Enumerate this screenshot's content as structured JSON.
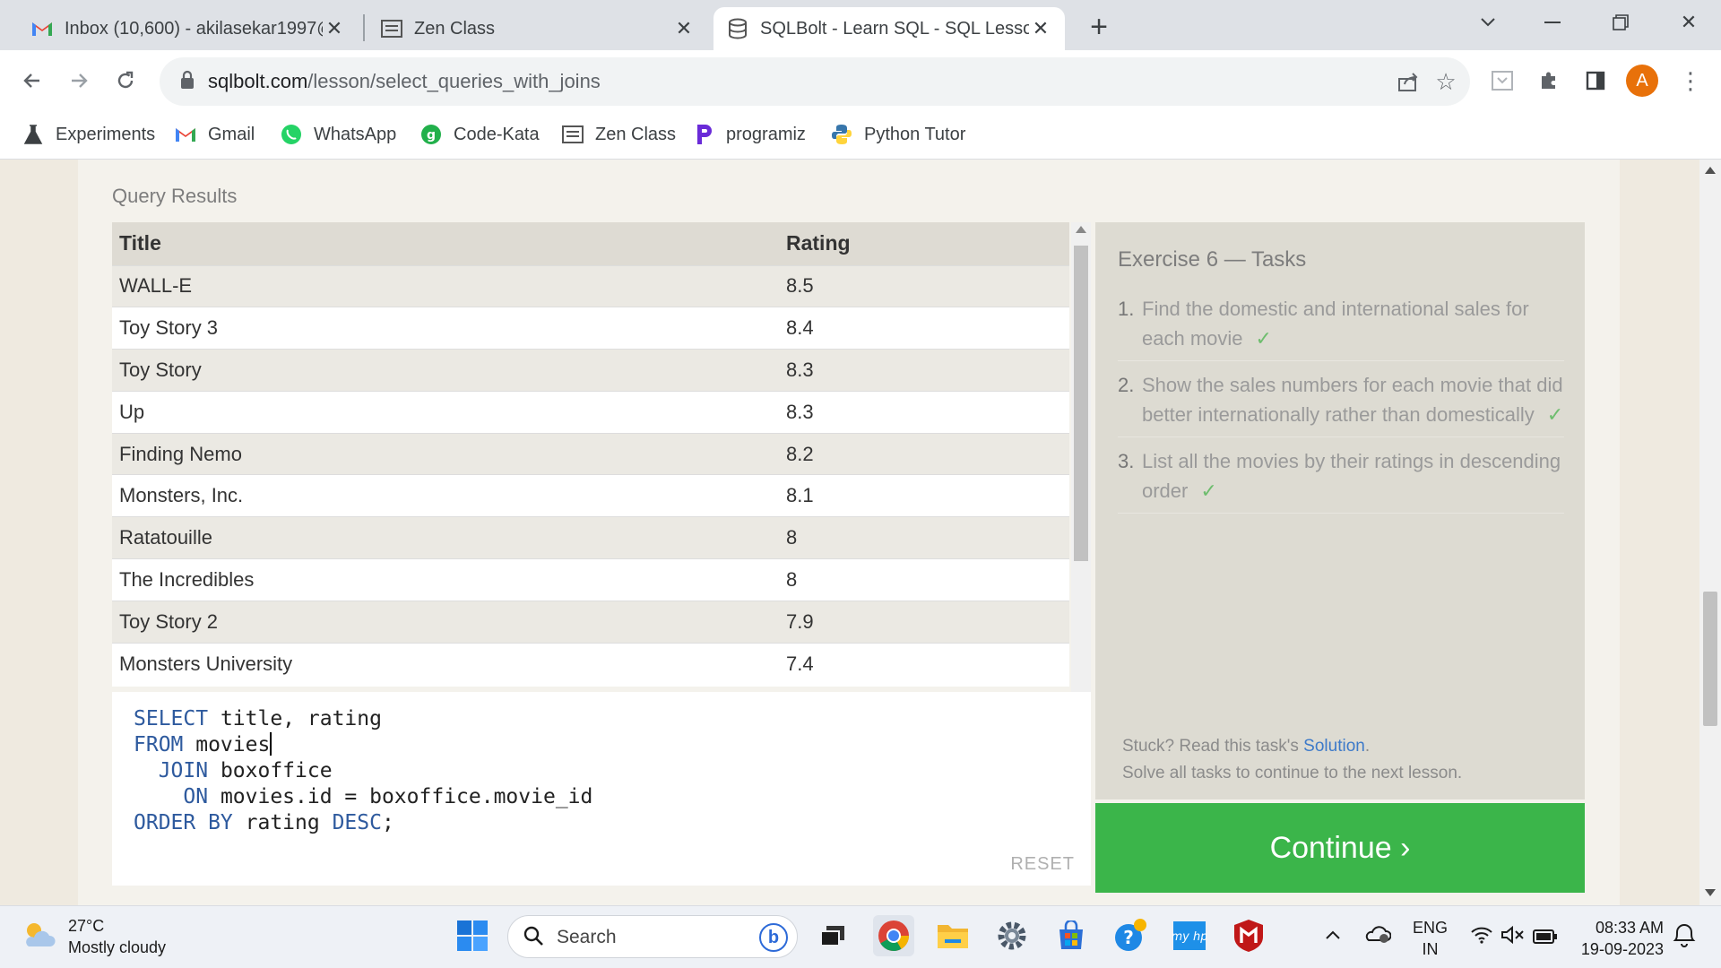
{
  "browser": {
    "tabs": [
      {
        "title": "Inbox (10,600) - akilasekar1997@",
        "icon": "gmail-icon"
      },
      {
        "title": "Zen Class",
        "icon": "zen-class-icon"
      },
      {
        "title": "SQLBolt - Learn SQL - SQL Lesson",
        "icon": "database-icon",
        "active": true
      }
    ],
    "url": {
      "host": "sqlbolt.com",
      "path": "/lesson/select_queries_with_joins"
    },
    "profile_initial": "A",
    "bookmarks": [
      {
        "label": "Experiments",
        "icon": "flask-icon"
      },
      {
        "label": "Gmail",
        "icon": "gmail-icon"
      },
      {
        "label": "WhatsApp",
        "icon": "whatsapp-icon"
      },
      {
        "label": "Code-Kata",
        "icon": "guvi-icon"
      },
      {
        "label": "Zen Class",
        "icon": "zen-class-icon"
      },
      {
        "label": "programiz",
        "icon": "programiz-icon"
      },
      {
        "label": "Python Tutor",
        "icon": "python-icon"
      }
    ]
  },
  "lesson": {
    "query_results_label": "Query Results",
    "table": {
      "headers": [
        "Title",
        "Rating"
      ],
      "rows": [
        [
          "WALL-E",
          "8.5"
        ],
        [
          "Toy Story 3",
          "8.4"
        ],
        [
          "Toy Story",
          "8.3"
        ],
        [
          "Up",
          "8.3"
        ],
        [
          "Finding Nemo",
          "8.2"
        ],
        [
          "Monsters, Inc.",
          "8.1"
        ],
        [
          "Ratatouille",
          "8"
        ],
        [
          "The Incredibles",
          "8"
        ],
        [
          "Toy Story 2",
          "7.9"
        ],
        [
          "Monsters University",
          "7.4"
        ]
      ]
    },
    "editor": {
      "lines": [
        {
          "kw": "SELECT",
          "rest": " title, rating"
        },
        {
          "kw": "FROM",
          "rest": " movies"
        },
        {
          "kw": "  JOIN",
          "rest": " boxoffice"
        },
        {
          "kw": "    ON",
          "rest": " movies.id = boxoffice.movie_id"
        },
        {
          "kw": "ORDER BY",
          "rest": " rating ",
          "kw2": "DESC",
          "tail": ";"
        }
      ],
      "reset_label": "RESET"
    },
    "tasks": {
      "heading": "Exercise 6 — Tasks",
      "items": [
        {
          "num": "1.",
          "text": "Find the domestic and international sales for each movie",
          "done": "✓"
        },
        {
          "num": "2.",
          "text": "Show the sales numbers for each movie that did better internationally rather than domestically",
          "done": "✓"
        },
        {
          "num": "3.",
          "text": "List all the movies by their ratings in descending order",
          "done": "✓"
        }
      ],
      "stuck_prefix": "Stuck? Read this task's ",
      "solution_link": "Solution",
      "stuck_suffix": ".",
      "solve_all": "Solve all tasks to continue to the next lesson."
    },
    "continue_label": "Continue ›"
  },
  "taskbar": {
    "weather_temp": "27°C",
    "weather_desc": "Mostly cloudy",
    "search_placeholder": "Search",
    "lang_top": "ENG",
    "lang_bottom": "IN",
    "time": "08:33 AM",
    "date": "19-09-2023"
  },
  "colors": {
    "continue": "#3bb54a",
    "keyword": "#2e5a9e",
    "link": "#3d7ac9"
  }
}
